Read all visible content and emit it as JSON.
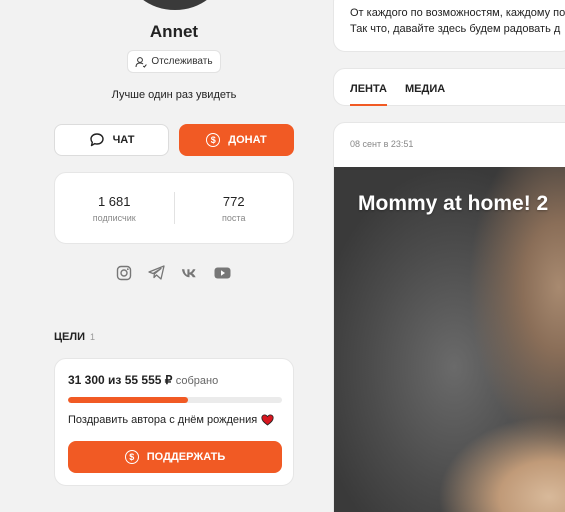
{
  "profile": {
    "name": "Annet",
    "follow_label": "Отслеживать",
    "tagline": "Лучше один раз увидеть"
  },
  "actions": {
    "chat_label": "ЧАТ",
    "donate_label": "ДОНАТ"
  },
  "stats": [
    {
      "value": "1 681",
      "label": "подписчик"
    },
    {
      "value": "772",
      "label": "поста"
    }
  ],
  "socials": [
    "instagram-icon",
    "telegram-icon",
    "vk-icon",
    "youtube-icon"
  ],
  "goals": {
    "heading": "ЦЕЛИ",
    "count": "1",
    "items": [
      {
        "collected": "31 300",
        "separator": "из",
        "target": "55 555 ₽",
        "suffix": "собрано",
        "progress_fraction": 0.563,
        "description": "Поздравить автора с днём рождения",
        "button_label": "ПОДДЕРЖАТЬ"
      }
    ]
  },
  "intro": {
    "line1": "От каждого по возможностям, каждому по",
    "line2": "Так что, давайте здесь будем радовать д"
  },
  "feed": {
    "tabs": [
      {
        "label": "ЛЕНТА",
        "active": true
      },
      {
        "label": "МЕДИА",
        "active": false
      }
    ],
    "post": {
      "date": "08 сент в 23:51",
      "title": "Mommy at home! 2"
    }
  },
  "colors": {
    "accent": "#f15a24",
    "background": "#f2f2f2"
  }
}
